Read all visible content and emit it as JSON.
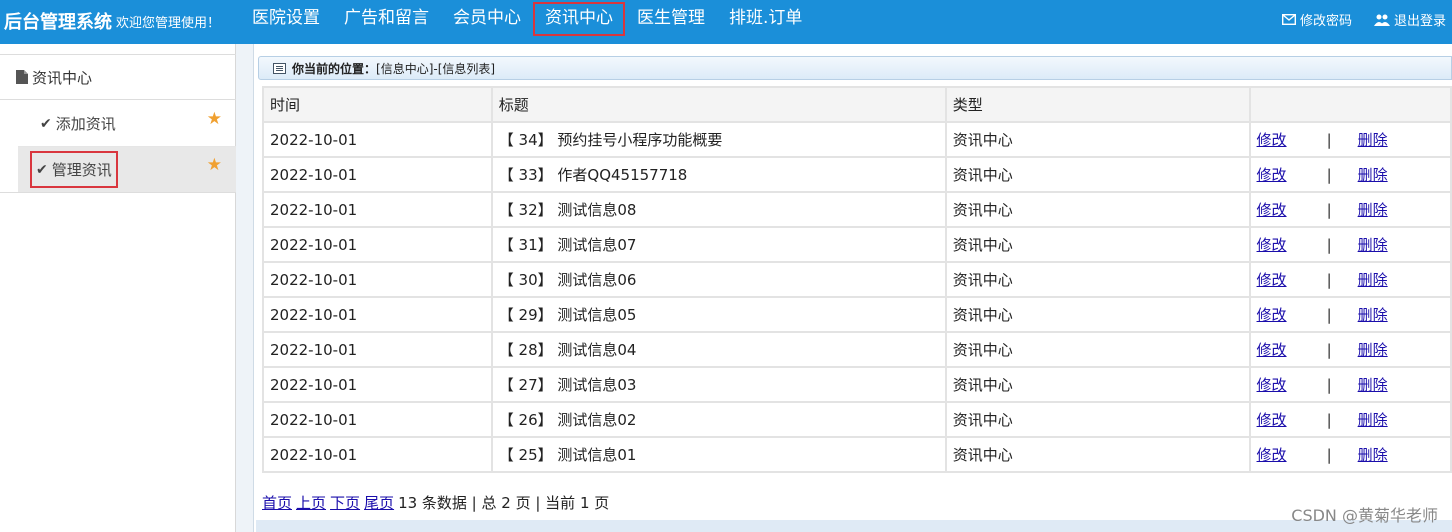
{
  "header": {
    "brand": "后台管理系统",
    "welcome": "欢迎您管理使用！",
    "nav": [
      "医院设置",
      "广告和留言",
      "会员中心",
      "资讯中心",
      "医生管理",
      "排班.订单"
    ],
    "active_nav": "资讯中心",
    "change_password": "修改密码",
    "logout": "退出登录"
  },
  "sidebar": {
    "title": "资讯中心",
    "items": [
      {
        "label": "添加资讯",
        "icon": "check-icon",
        "star": "star-icon"
      },
      {
        "label": "管理资讯",
        "icon": "check-icon",
        "star": "star-icon"
      }
    ],
    "active_item": "管理资讯"
  },
  "breadcrumb": {
    "prefix": "你当前的位置：",
    "path": "[信息中心]-[信息列表]"
  },
  "table": {
    "columns": [
      "时间",
      "标题",
      "类型",
      ""
    ],
    "rows": [
      {
        "date": "2022-10-01",
        "title": "【 34】 预约挂号小程序功能概要",
        "type": "资讯中心"
      },
      {
        "date": "2022-10-01",
        "title": "【 33】 作者QQ45157718",
        "type": "资讯中心"
      },
      {
        "date": "2022-10-01",
        "title": "【 32】 测试信息08",
        "type": "资讯中心"
      },
      {
        "date": "2022-10-01",
        "title": "【 31】 测试信息07",
        "type": "资讯中心"
      },
      {
        "date": "2022-10-01",
        "title": "【 30】 测试信息06",
        "type": "资讯中心"
      },
      {
        "date": "2022-10-01",
        "title": "【 29】 测试信息05",
        "type": "资讯中心"
      },
      {
        "date": "2022-10-01",
        "title": "【 28】 测试信息04",
        "type": "资讯中心"
      },
      {
        "date": "2022-10-01",
        "title": "【 27】 测试信息03",
        "type": "资讯中心"
      },
      {
        "date": "2022-10-01",
        "title": "【 26】 测试信息02",
        "type": "资讯中心"
      },
      {
        "date": "2022-10-01",
        "title": "【 25】 测试信息01",
        "type": "资讯中心"
      }
    ],
    "edit_label": "修改",
    "delete_label": "删除",
    "separator": "|"
  },
  "pager": {
    "first": "首页",
    "prev": "上页",
    "next": "下页",
    "last": "尾页",
    "summary": "13 条数据 | 总 2 页 | 当前 1 页"
  },
  "watermark": "CSDN @黄菊华老师",
  "colors": {
    "topbar": "#1b8fd9",
    "highlight_box": "#d9363e",
    "link": "#1a0dab",
    "star": "#f0a030"
  }
}
